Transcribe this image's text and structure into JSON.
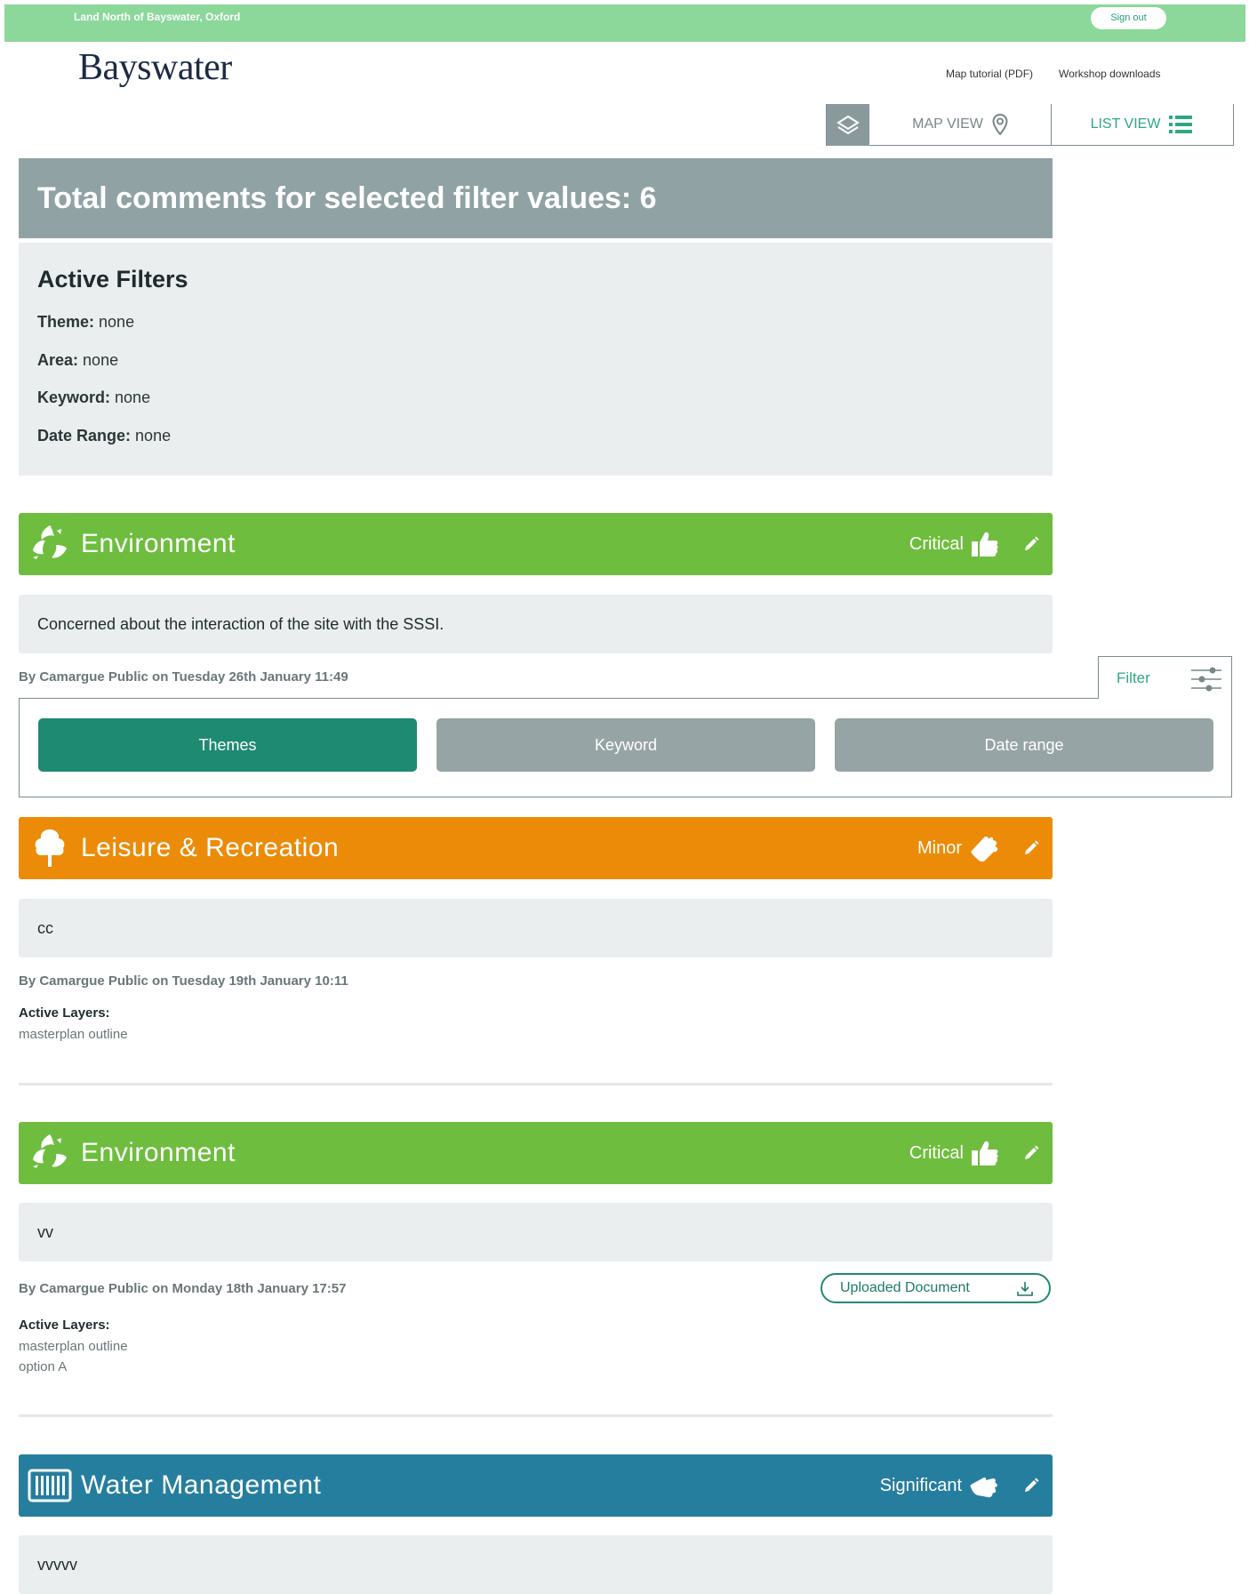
{
  "topbar": {
    "site_title": "Land North of Bayswater, Oxford",
    "sign_out": "Sign out"
  },
  "header": {
    "logo": "Bayswater",
    "links": [
      "Map tutorial (PDF)",
      "Workshop downloads"
    ]
  },
  "views": {
    "map": "MAP VIEW",
    "list": "LIST VIEW",
    "active": "list"
  },
  "summary": {
    "total_label": "Total comments for selected filter values: 6",
    "active_filters_title": "Active Filters",
    "filters": [
      {
        "label": "Theme:",
        "value": "none"
      },
      {
        "label": "Area:",
        "value": "none"
      },
      {
        "label": "Keyword:",
        "value": "none"
      },
      {
        "label": "Date Range:",
        "value": "none"
      }
    ]
  },
  "comments": [
    {
      "theme": "Environment",
      "color": "#6ebd3e",
      "icon": "recycle-leaf-icon",
      "severity": "Critical",
      "severity_icon": "thumbs-up-icon",
      "text": "Concerned about the interaction of the site with the SSSI.",
      "byline": "By Camargue Public on Tuesday 26th January 11:49"
    },
    {
      "theme": "Leisure & Recreation",
      "color": "#ec8b08",
      "icon": "tree-icon",
      "severity": "Minor",
      "severity_icon": "hand-tilted-icon",
      "text": "cc",
      "byline": "By Camargue Public on Tuesday 19th January 10:11",
      "active_layers_label": "Active Layers:",
      "active_layers": [
        "masterplan outline"
      ]
    },
    {
      "theme": "Environment",
      "color": "#6ebd3e",
      "icon": "recycle-leaf-icon",
      "severity": "Critical",
      "severity_icon": "thumbs-up-icon",
      "text": "vv",
      "byline": "By Camargue Public on Monday 18th January 17:57",
      "uploaded_document": "Uploaded Document",
      "active_layers_label": "Active Layers:",
      "active_layers": [
        "masterplan outline",
        "option A"
      ]
    },
    {
      "theme": "Water Management",
      "color": "#267e9e",
      "icon": "grate-icon",
      "severity": "Significant",
      "severity_icon": "hand-tilted-icon",
      "text": "vvvvv"
    }
  ],
  "filter_panel": {
    "tab_label": "Filter",
    "buttons": [
      {
        "label": "Themes",
        "color": "#1e8a72",
        "active": true
      },
      {
        "label": "Keyword",
        "color": "#97a4a5",
        "active": false
      },
      {
        "label": "Date range",
        "color": "#97a4a5",
        "active": false
      }
    ]
  }
}
